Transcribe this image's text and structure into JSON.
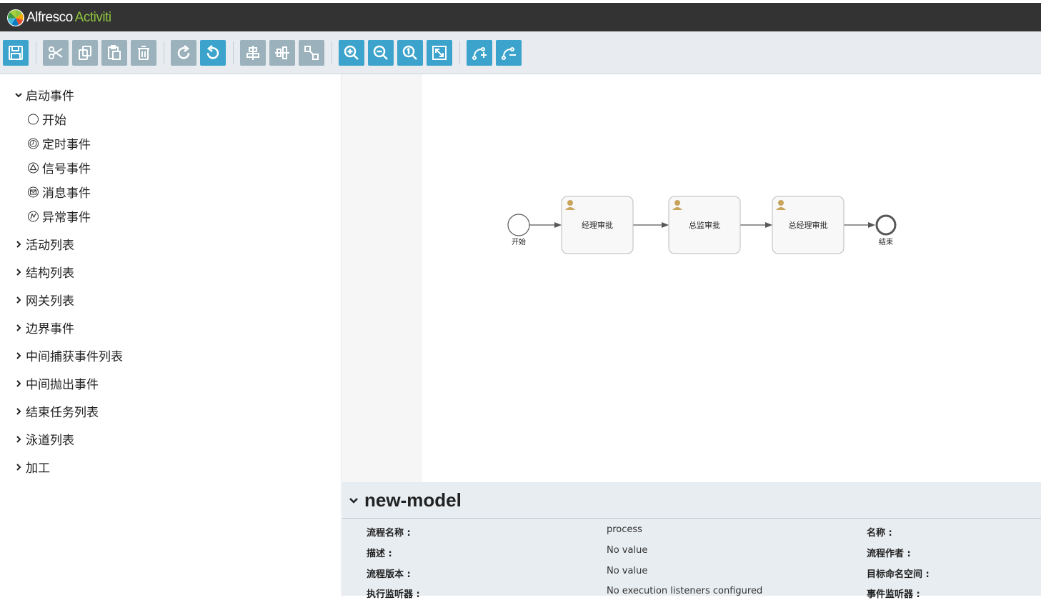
{
  "app": {
    "brand_part1": "Alfresco",
    "brand_part2": "Activiti"
  },
  "toolbar": {
    "buttons": [
      {
        "name": "save-button",
        "icon": "save-icon",
        "color": "#3ba3cc"
      },
      {
        "name": "cut-button",
        "icon": "scissors-icon",
        "color": "#9bb1bb"
      },
      {
        "name": "copy-button",
        "icon": "copy-icon",
        "color": "#9bb1bb"
      },
      {
        "name": "paste-button",
        "icon": "paste-icon",
        "color": "#9bb1bb"
      },
      {
        "name": "delete-button",
        "icon": "trash-icon",
        "color": "#9bb1bb"
      },
      {
        "name": "redo-button",
        "icon": "redo-icon",
        "color": "#9bb1bb"
      },
      {
        "name": "undo-button",
        "icon": "undo-icon",
        "color": "#3ba3cc"
      },
      {
        "name": "align-horizontal-button",
        "icon": "align-horizontal-icon",
        "color": "#9bb1bb"
      },
      {
        "name": "align-vertical-button",
        "icon": "align-vertical-icon",
        "color": "#9bb1bb"
      },
      {
        "name": "same-size-button",
        "icon": "same-size-icon",
        "color": "#9bb1bb"
      },
      {
        "name": "zoom-in-button",
        "icon": "zoom-in-icon",
        "color": "#3ba3cc"
      },
      {
        "name": "zoom-out-button",
        "icon": "zoom-out-icon",
        "color": "#3ba3cc"
      },
      {
        "name": "zoom-actual-button",
        "icon": "zoom-actual-icon",
        "color": "#3ba3cc"
      },
      {
        "name": "zoom-fit-button",
        "icon": "zoom-fit-icon",
        "color": "#3ba3cc"
      },
      {
        "name": "add-bendpoint-button",
        "icon": "add-bendpoint-icon",
        "color": "#3ba3cc"
      },
      {
        "name": "remove-bendpoint-button",
        "icon": "remove-bendpoint-icon",
        "color": "#3ba3cc"
      }
    ]
  },
  "sidebar": {
    "start_group": {
      "label": "启动事件",
      "items": [
        {
          "label": "开始",
          "icon": "circle-icon"
        },
        {
          "label": "定时事件",
          "icon": "timer-icon"
        },
        {
          "label": "信号事件",
          "icon": "signal-icon"
        },
        {
          "label": "消息事件",
          "icon": "message-icon"
        },
        {
          "label": "异常事件",
          "icon": "error-icon"
        }
      ]
    },
    "groups": [
      {
        "label": "活动列表"
      },
      {
        "label": "结构列表"
      },
      {
        "label": "网关列表"
      },
      {
        "label": "边界事件"
      },
      {
        "label": "中间捕获事件列表"
      },
      {
        "label": "中间抛出事件"
      },
      {
        "label": "结束任务列表"
      },
      {
        "label": "泳道列表"
      },
      {
        "label": "加工"
      }
    ]
  },
  "diagram": {
    "start_label": "开始",
    "end_label": "结束",
    "tasks": [
      {
        "label": "经理审批",
        "icon": "user-icon"
      },
      {
        "label": "总监审批",
        "icon": "user-icon"
      },
      {
        "label": "总经理审批",
        "icon": "user-icon"
      }
    ]
  },
  "properties": {
    "title": "new-model",
    "rows": [
      {
        "label": "流程名称 :",
        "value": "process",
        "label2": "名称 :"
      },
      {
        "label": "描述 :",
        "value": "No value",
        "label2": "流程作者 :"
      },
      {
        "label": "流程版本 :",
        "value": "No value",
        "label2": "目标命名空间 :"
      },
      {
        "label": "执行监听器 :",
        "value": "No execution listeners configured",
        "label2": "事件监听器 :"
      }
    ]
  }
}
